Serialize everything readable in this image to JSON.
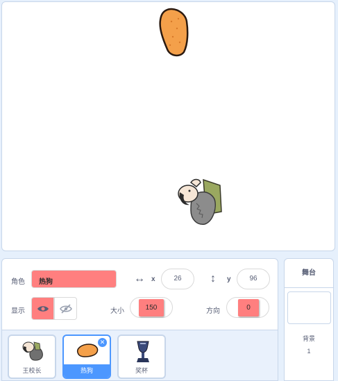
{
  "sprite_info": {
    "sprite_label": "角色",
    "sprite_name": "热狗",
    "x_label": "x",
    "x_value": "26",
    "y_label": "y",
    "y_value": "96",
    "show_label": "显示",
    "size_label": "大小",
    "size_value": "150",
    "direction_label": "方向",
    "direction_value": "0"
  },
  "sprites": [
    {
      "name": "王校长",
      "icon": "principal-icon",
      "selected": false
    },
    {
      "name": "热狗",
      "icon": "hotdog-icon",
      "selected": true
    },
    {
      "name": "奖杯",
      "icon": "trophy-icon",
      "selected": false
    }
  ],
  "stage_panel": {
    "title": "舞台",
    "backdrop_label": "背景",
    "backdrop_count": "1"
  },
  "colors": {
    "accent": "#4c97ff",
    "field_highlight": "#ff7f7f",
    "panel_bg": "#e6f0fc"
  }
}
